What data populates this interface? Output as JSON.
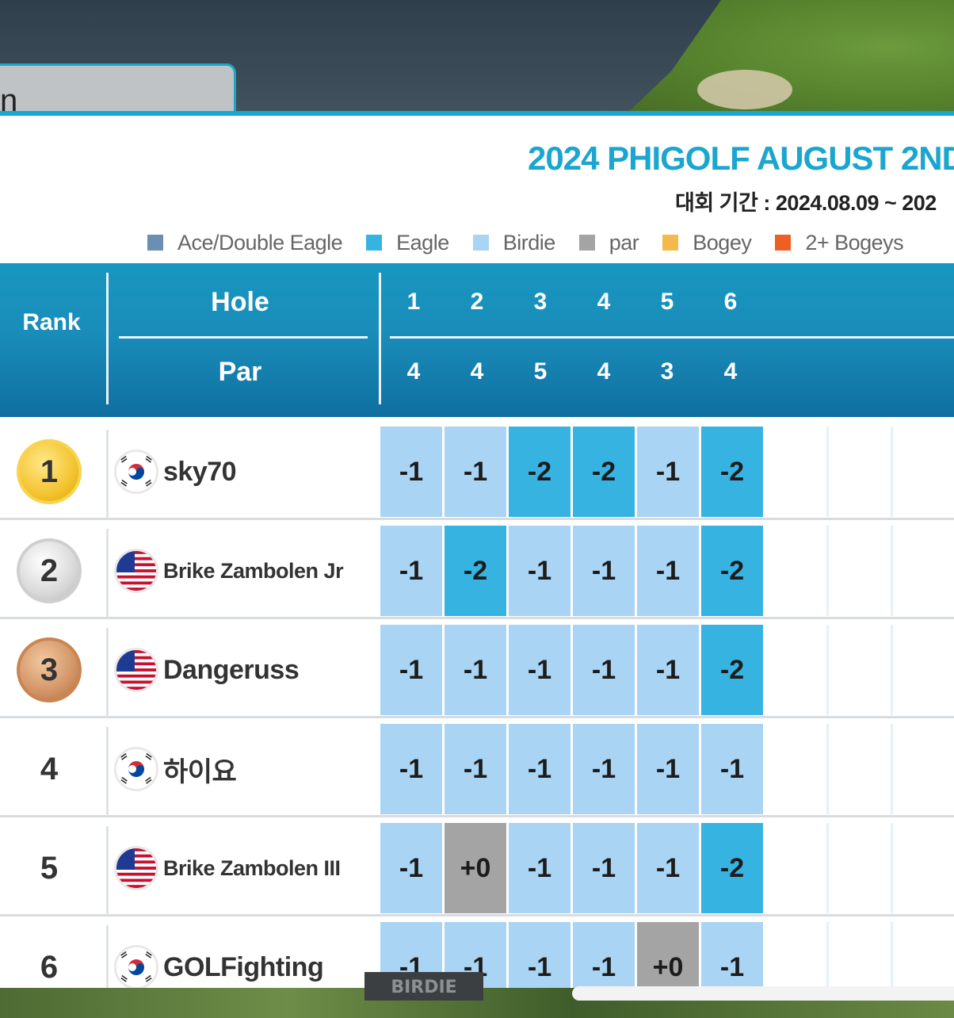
{
  "tab": {
    "label": "n"
  },
  "bottom": {
    "label": "BIRDIE"
  },
  "title": "2024 PHIGOLF AUGUST 2ND",
  "period": "대회 기간 : 2024.08.09 ~ 202",
  "legend": [
    {
      "label": "Ace/Double Eagle",
      "color": "#6b8fb3"
    },
    {
      "label": "Eagle",
      "color": "#37b3e2"
    },
    {
      "label": "Birdie",
      "color": "#a9d4f3"
    },
    {
      "label": "par",
      "color": "#a4a4a4"
    },
    {
      "label": "Bogey",
      "color": "#f3b94a"
    },
    {
      "label": "2+ Bogeys",
      "color": "#ee5f23"
    }
  ],
  "header": {
    "rank": "Rank",
    "hole": "Hole",
    "par": "Par",
    "holes": [
      "1",
      "2",
      "3",
      "4",
      "5",
      "6"
    ],
    "pars": [
      "4",
      "4",
      "5",
      "4",
      "3",
      "4"
    ]
  },
  "colors": {
    "eagle": "#37b3e2",
    "birdie": "#a9d4f3",
    "par": "#a4a4a4"
  },
  "players": [
    {
      "rank": "1",
      "medal": "gold",
      "flag": "kr",
      "name": "sky70",
      "scores": [
        "-1",
        "-1",
        "-2",
        "-2",
        "-1",
        "-2"
      ]
    },
    {
      "rank": "2",
      "medal": "silver",
      "flag": "us",
      "name": "Brike Zambolen Jr",
      "scores": [
        "-1",
        "-2",
        "-1",
        "-1",
        "-1",
        "-2"
      ]
    },
    {
      "rank": "3",
      "medal": "bronze",
      "flag": "us",
      "name": "Dangeruss",
      "scores": [
        "-1",
        "-1",
        "-1",
        "-1",
        "-1",
        "-2"
      ]
    },
    {
      "rank": "4",
      "medal": "",
      "flag": "kr",
      "name": "하이요",
      "scores": [
        "-1",
        "-1",
        "-1",
        "-1",
        "-1",
        "-1"
      ]
    },
    {
      "rank": "5",
      "medal": "",
      "flag": "us",
      "name": "Brike Zambolen III",
      "scores": [
        "-1",
        "+0",
        "-1",
        "-1",
        "-1",
        "-2"
      ]
    },
    {
      "rank": "6",
      "medal": "",
      "flag": "kr",
      "name": "GOLFighting",
      "scores": [
        "-1",
        "-1",
        "-1",
        "-1",
        "+0",
        "-1"
      ]
    }
  ]
}
